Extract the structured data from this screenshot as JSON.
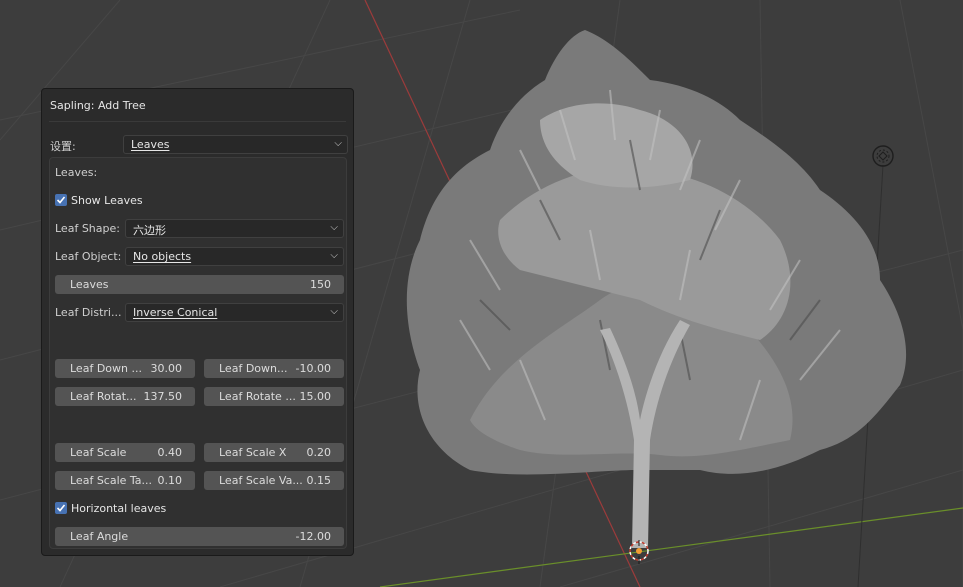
{
  "panel": {
    "title": "Sapling: Add Tree",
    "settings_label": "设置:",
    "settings_value": "Leaves",
    "section_title": "Leaves:",
    "show_leaves": {
      "label": "Show Leaves",
      "checked": true
    },
    "leaf_shape": {
      "label": "Leaf Shape:",
      "value": "六边形"
    },
    "leaf_object": {
      "label": "Leaf Object:",
      "value": "No objects"
    },
    "leaves": {
      "label": "Leaves",
      "value": "150"
    },
    "leaf_distribution": {
      "label": "Leaf Distri...",
      "value": "Inverse Conical"
    },
    "leaf_down_1": {
      "label": "Leaf Down ...",
      "value": "30.00"
    },
    "leaf_down_2": {
      "label": "Leaf Down...",
      "value": "-10.00"
    },
    "leaf_rotate_1": {
      "label": "Leaf Rotat...",
      "value": "137.50"
    },
    "leaf_rotate_2": {
      "label": "Leaf Rotate ...",
      "value": "15.00"
    },
    "leaf_scale": {
      "label": "Leaf Scale",
      "value": "0.40"
    },
    "leaf_scale_x": {
      "label": "Leaf Scale X",
      "value": "0.20"
    },
    "leaf_scale_taper": {
      "label": "Leaf Scale Ta...",
      "value": "0.10"
    },
    "leaf_scale_var": {
      "label": "Leaf Scale Va...",
      "value": "0.15"
    },
    "horizontal_leaves": {
      "label": "Horizontal leaves",
      "checked": true
    },
    "leaf_angle": {
      "label": "Leaf Angle",
      "value": "-12.00"
    }
  },
  "colors": {
    "viewport_bg": "#3d3d3d",
    "grid_line": "#474747",
    "x_axis": "#9c3b3b",
    "y_axis": "#6a8f2a",
    "accent": "#4772b3",
    "slider_bg": "#545454",
    "panel_bg": "#2b2b2b"
  },
  "icons": {
    "light": "light-gizmo-icon",
    "cursor": "3d-cursor-icon",
    "check": "checkmark-icon",
    "chevron": "chevron-down-icon"
  }
}
